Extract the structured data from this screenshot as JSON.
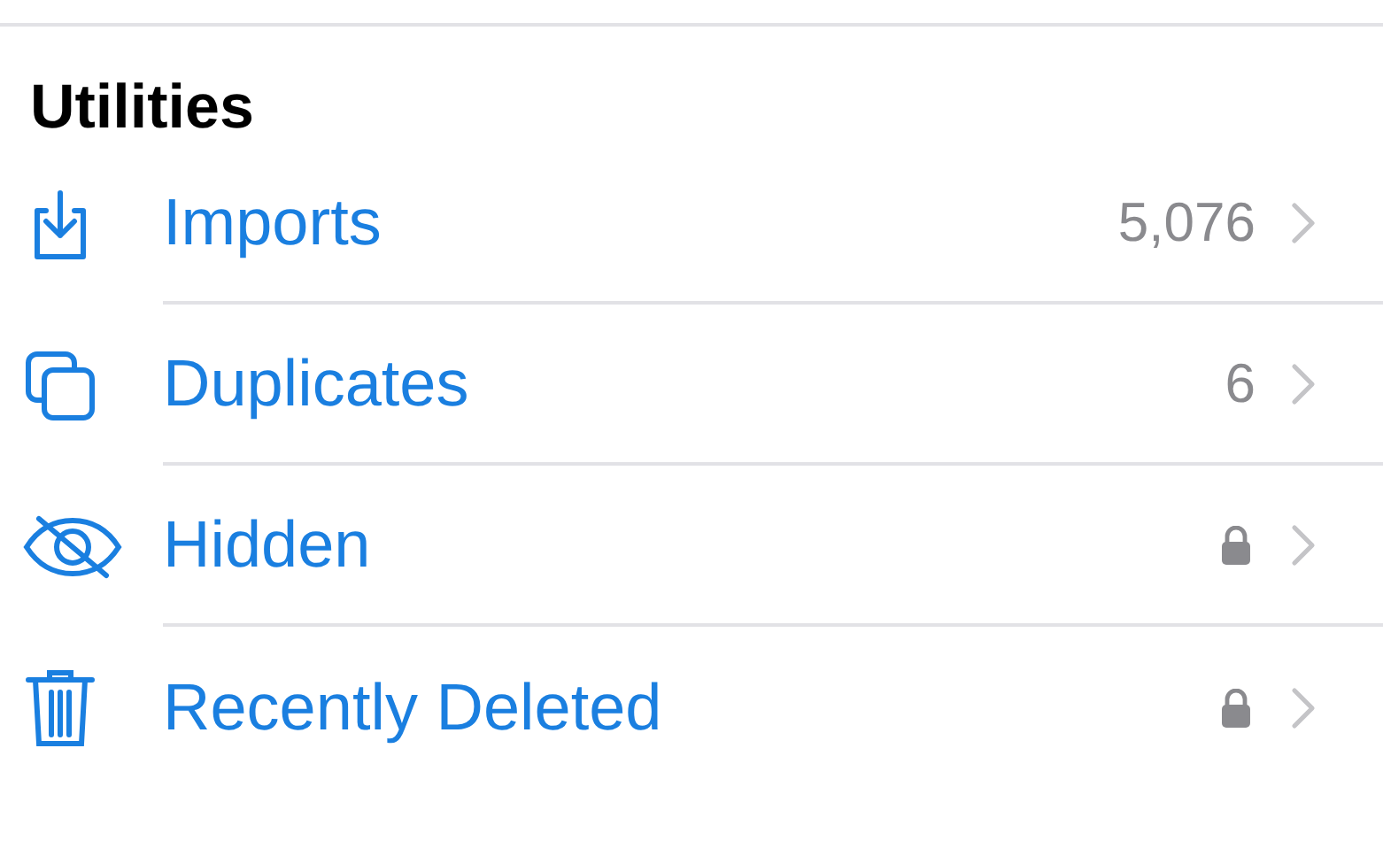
{
  "section": {
    "title": "Utilities"
  },
  "rows": [
    {
      "label": "Imports",
      "kind": "count",
      "detail": "5,076"
    },
    {
      "label": "Duplicates",
      "kind": "count",
      "detail": "6"
    },
    {
      "label": "Hidden",
      "kind": "locked"
    },
    {
      "label": "Recently Deleted",
      "kind": "locked"
    }
  ]
}
